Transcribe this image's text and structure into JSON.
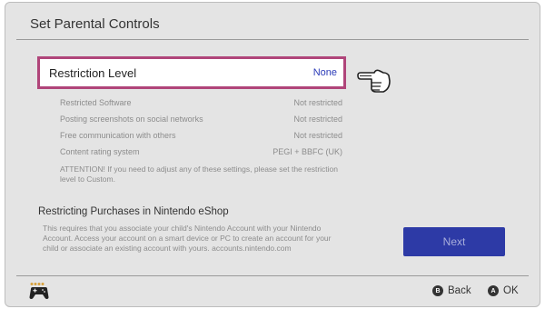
{
  "header": {
    "title": "Set Parental Controls"
  },
  "restriction": {
    "label": "Restriction Level",
    "value": "None"
  },
  "settings": [
    {
      "label": "Restricted Software",
      "value": "Not restricted"
    },
    {
      "label": "Posting screenshots on social networks",
      "value": "Not restricted"
    },
    {
      "label": "Free communication with others",
      "value": "Not restricted"
    },
    {
      "label": "Content rating system",
      "value": "PEGI + BBFC (UK)"
    }
  ],
  "attention_text": "ATTENTION! If you need to adjust any of these settings, please set the restriction level to Custom.",
  "purchases": {
    "title": "Restricting Purchases in Nintendo eShop",
    "description": "This requires that you associate your child's Nintendo Account with your Nintendo Account. Access your account on a smart device or PC to create an account for your child or associate an existing account with yours. accounts.nintendo.com"
  },
  "next_button": {
    "label": "Next"
  },
  "footer": {
    "back": {
      "glyph": "B",
      "label": "Back"
    },
    "ok": {
      "glyph": "A",
      "label": "OK"
    }
  },
  "icons": {
    "pointer": "pointing-hand-icon",
    "controller": "controller-icon"
  },
  "colors": {
    "selection_border": "#b0457a",
    "accent_blue": "#2d3aa6",
    "value_blue": "#2b3bb8"
  }
}
